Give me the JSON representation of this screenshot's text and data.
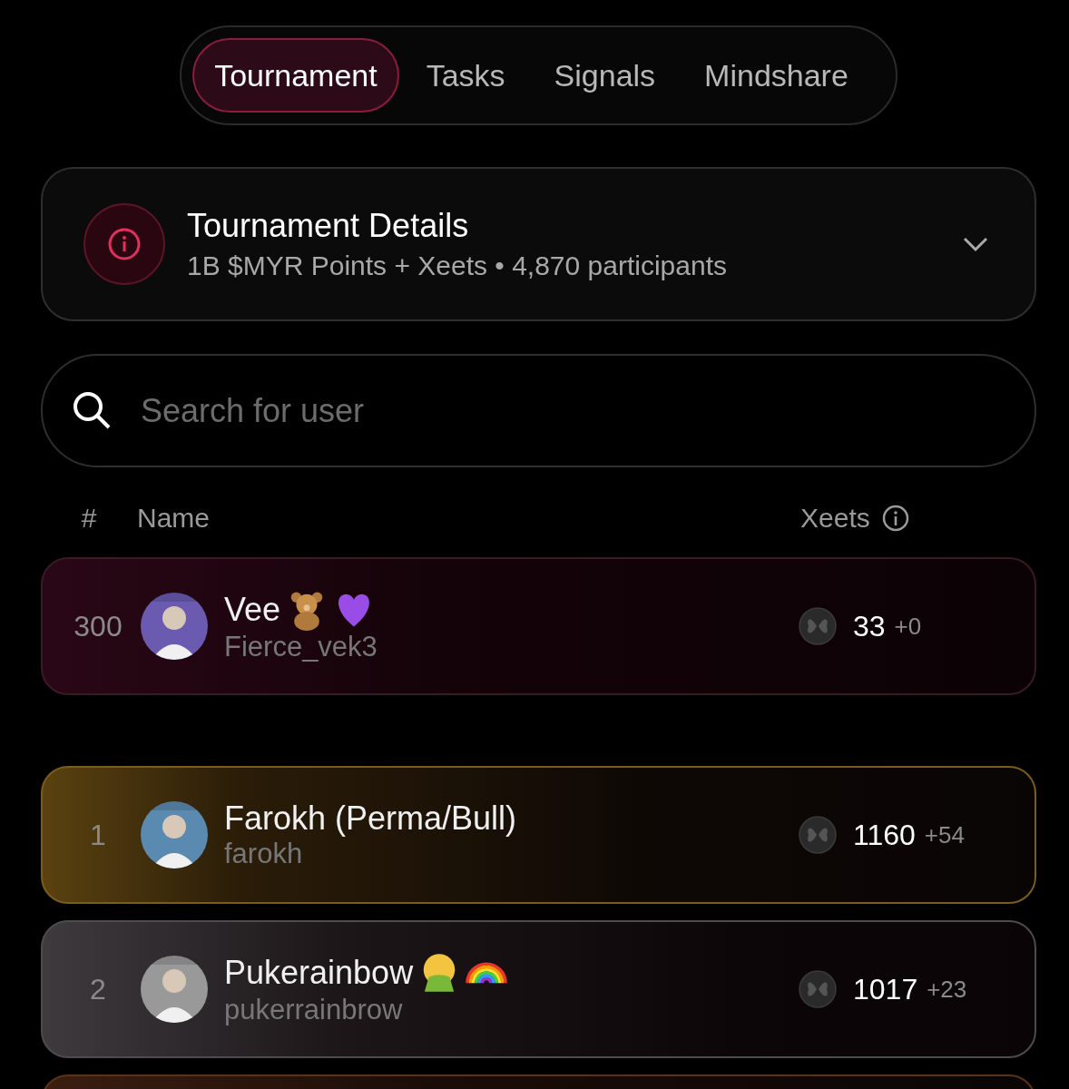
{
  "tabs": [
    {
      "label": "Tournament",
      "selected": true
    },
    {
      "label": "Tasks",
      "selected": false
    },
    {
      "label": "Signals",
      "selected": false
    },
    {
      "label": "Mindshare",
      "selected": false
    }
  ],
  "details": {
    "title": "Tournament Details",
    "subtitle": "1B $MYR Points + Xeets • 4,870 participants",
    "expanded": false
  },
  "search": {
    "placeholder": "Search for user"
  },
  "table": {
    "columns": [
      "#",
      "Name",
      "Xeets"
    ],
    "current_user": {
      "kind": "self",
      "rank": "300",
      "name": "Vee",
      "emoji": [
        {
          "kind": "bear"
        },
        {
          "kind": "heart"
        }
      ],
      "handle": "Fierce_vek3",
      "xeets": "33",
      "change": "+0",
      "avatar": {
        "kind": "picture"
      }
    },
    "rows": [
      {
        "kind": "gold",
        "rank": "1",
        "name": "Farokh (Perma/Bull)",
        "emoji": [],
        "handle": "farokh",
        "xeets": "1160",
        "change": "+54",
        "avatar": {
          "kind": "picture"
        }
      },
      {
        "kind": "silver",
        "rank": "2",
        "name": "Pukerainbow",
        "emoji": [
          {
            "kind": "vomit"
          },
          {
            "kind": "rainbow"
          }
        ],
        "handle": "pukerrainbrow",
        "xeets": "1017",
        "change": "+23",
        "avatar": {
          "kind": "picture"
        }
      },
      {
        "kind": "bronze",
        "avatar": {
          "kind": "none"
        }
      }
    ]
  }
}
